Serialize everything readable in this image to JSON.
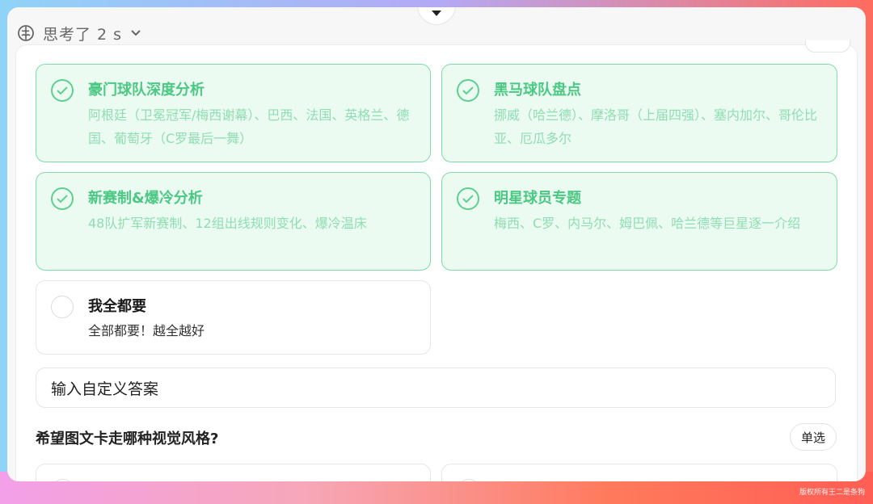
{
  "thinking": {
    "label": "思考了 2 s",
    "icon": "brain-icon"
  },
  "options": [
    {
      "title": "豪门球队深度分析",
      "desc": "阿根廷（卫冕冠军/梅西谢幕）、巴西、法国、英格兰、德国、葡萄牙（C罗最后一舞）",
      "selected": true
    },
    {
      "title": "黑马球队盘点",
      "desc": "挪威（哈兰德）、摩洛哥（上届四强）、塞内加尔、哥伦比亚、厄瓜多尔",
      "selected": true
    },
    {
      "title": "新赛制&爆冷分析",
      "desc": "48队扩军新赛制、12组出线规则变化、爆冷温床",
      "selected": true
    },
    {
      "title": "明星球员专题",
      "desc": "梅西、C罗、内马尔、姆巴佩、哈兰德等巨星逐一介绍",
      "selected": true
    },
    {
      "title": "我全都要",
      "desc": "全部都要！越全越好",
      "selected": false
    }
  ],
  "custom_answer": {
    "placeholder": "输入自定义答案"
  },
  "next_question": {
    "text": "希望图文卡走哪种视觉风格?",
    "badge": "单选",
    "options_visible": [
      "",
      ""
    ]
  },
  "watermark": "版权所有王二是条狗",
  "colors": {
    "selected_border": "#7fdca8",
    "selected_bg": "#ebfbf2",
    "selected_text": "#4bc883"
  }
}
